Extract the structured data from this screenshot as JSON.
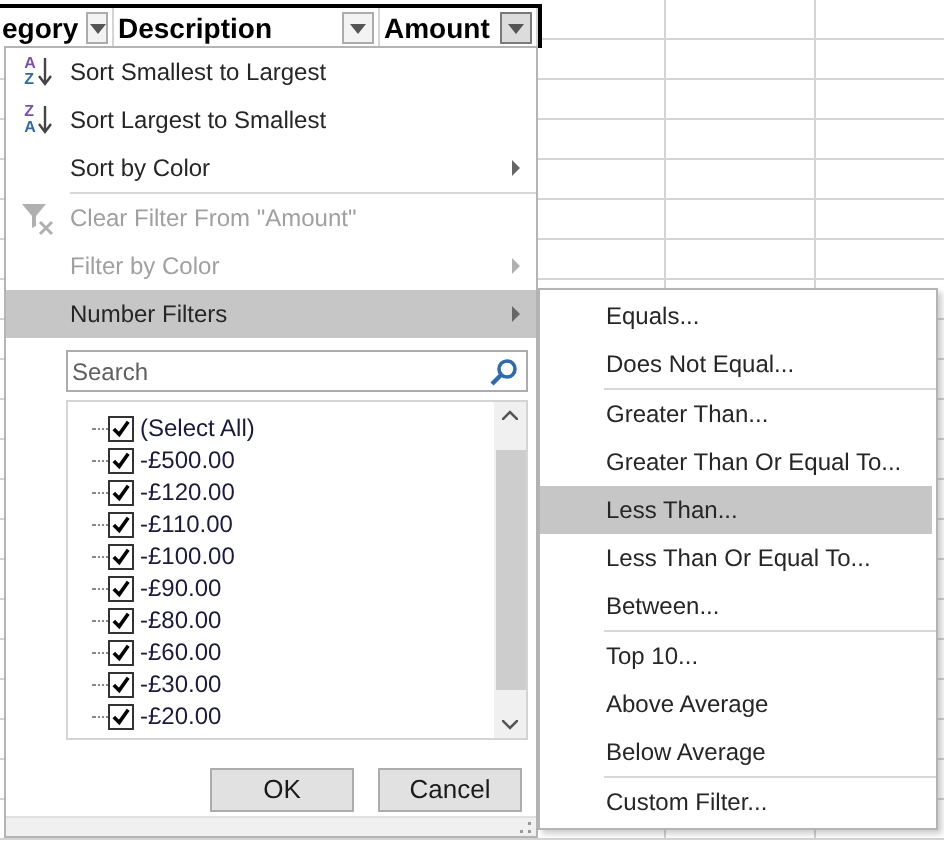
{
  "header": {
    "columns": [
      {
        "label": "egory",
        "filter_pressed": false
      },
      {
        "label": "Description",
        "filter_pressed": false
      },
      {
        "label": "Amount",
        "filter_pressed": true
      }
    ]
  },
  "menu": {
    "items": [
      {
        "kind": "sort_ascending",
        "icon_text": [
          "A",
          "Z"
        ],
        "label": "Sort Smallest to Largest",
        "disabled": false,
        "submenu": false,
        "selected": false
      },
      {
        "kind": "sort_descending",
        "icon_text": [
          "Z",
          "A"
        ],
        "label": "Sort Largest to Smallest",
        "disabled": false,
        "submenu": false,
        "selected": false
      },
      {
        "kind": "command",
        "label": "Sort by Color",
        "disabled": false,
        "submenu": true,
        "selected": false
      },
      {
        "kind": "separator"
      },
      {
        "kind": "clear_filter",
        "label": "Clear Filter From \"Amount\"",
        "disabled": true,
        "submenu": false,
        "selected": false
      },
      {
        "kind": "command",
        "label": "Filter by Color",
        "disabled": true,
        "submenu": true,
        "selected": false
      },
      {
        "kind": "command",
        "label": "Number Filters",
        "disabled": false,
        "submenu": true,
        "selected": true
      }
    ],
    "search": {
      "placeholder": "Search"
    },
    "values": [
      {
        "label": "(Select All)",
        "checked": true
      },
      {
        "label": "-£500.00",
        "checked": true
      },
      {
        "label": "-£120.00",
        "checked": true
      },
      {
        "label": "-£110.00",
        "checked": true
      },
      {
        "label": "-£100.00",
        "checked": true
      },
      {
        "label": "-£90.00",
        "checked": true
      },
      {
        "label": "-£80.00",
        "checked": true
      },
      {
        "label": "-£60.00",
        "checked": true
      },
      {
        "label": "-£30.00",
        "checked": true
      },
      {
        "label": "-£20.00",
        "checked": true
      }
    ],
    "buttons": [
      "OK",
      "Cancel"
    ]
  },
  "submenu": {
    "items": [
      {
        "kind": "command",
        "label": "Equals...",
        "selected": false
      },
      {
        "kind": "command",
        "label": "Does Not Equal...",
        "selected": false
      },
      {
        "kind": "separator"
      },
      {
        "kind": "command",
        "label": "Greater Than...",
        "selected": false
      },
      {
        "kind": "command",
        "label": "Greater Than Or Equal To...",
        "selected": false
      },
      {
        "kind": "command",
        "label": "Less Than...",
        "selected": true
      },
      {
        "kind": "command",
        "label": "Less Than Or Equal To...",
        "selected": false
      },
      {
        "kind": "command",
        "label": "Between...",
        "selected": false
      },
      {
        "kind": "separator"
      },
      {
        "kind": "command",
        "label": "Top 10...",
        "selected": false
      },
      {
        "kind": "command",
        "label": "Above Average",
        "selected": false
      },
      {
        "kind": "command",
        "label": "Below Average",
        "selected": false
      },
      {
        "kind": "separator"
      },
      {
        "kind": "command",
        "label": "Custom Filter...",
        "selected": false
      }
    ]
  }
}
